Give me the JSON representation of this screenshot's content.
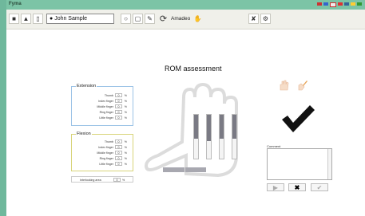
{
  "app": {
    "title": "Fyma"
  },
  "toolbar": {
    "user_name": "John Sample",
    "app_label": "Amadeo"
  },
  "main": {
    "heading": "ROM assessment"
  },
  "extension": {
    "legend": "Extension",
    "rows": [
      {
        "label": "Thumb",
        "value": "0",
        "unit": "%"
      },
      {
        "label": "Index finger",
        "value": "0",
        "unit": "%"
      },
      {
        "label": "Middle finger",
        "value": "0",
        "unit": "%"
      },
      {
        "label": "Ring finger",
        "value": "0",
        "unit": "%"
      },
      {
        "label": "Little finger",
        "value": "0",
        "unit": "%"
      }
    ]
  },
  "flexion": {
    "legend": "Flexion",
    "rows": [
      {
        "label": "Thumb",
        "value": "0",
        "unit": "%"
      },
      {
        "label": "Index finger",
        "value": "0",
        "unit": "%"
      },
      {
        "label": "Middle finger",
        "value": "0",
        "unit": "%"
      },
      {
        "label": "Ring finger",
        "value": "0",
        "unit": "%"
      },
      {
        "label": "Little finger",
        "value": "0",
        "unit": "%"
      }
    ]
  },
  "summary": {
    "label": "Interlocking area",
    "value": "0",
    "unit": "%"
  },
  "comment": {
    "label": "Comment",
    "value": ""
  },
  "fingers": [
    {
      "name": "index",
      "fill": 0.55
    },
    {
      "name": "middle",
      "fill": 0.6
    },
    {
      "name": "ring",
      "fill": 0.55
    },
    {
      "name": "little",
      "fill": 0.55
    }
  ],
  "colors": {
    "accent_green": "#7cc4a6",
    "background_green": "#6fb89c",
    "extension_border": "#9cc3e6",
    "flexion_border": "#d8d47a"
  }
}
